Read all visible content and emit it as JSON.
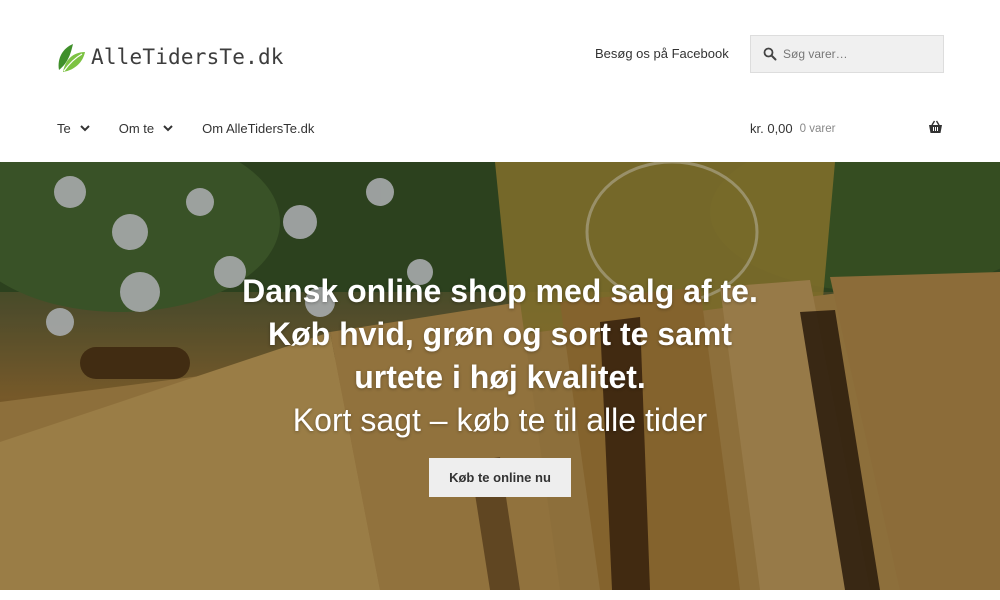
{
  "header": {
    "logo_text": "AlleTidersTe.dk",
    "facebook_link": "Besøg os på Facebook",
    "search": {
      "placeholder": "Søg varer…",
      "value": ""
    },
    "nav": [
      {
        "label": "Te",
        "has_dropdown": true
      },
      {
        "label": "Om te",
        "has_dropdown": true
      },
      {
        "label": "Om AlleTidersTe.dk",
        "has_dropdown": false
      }
    ],
    "cart": {
      "amount": "kr. 0,00",
      "count": "0 varer"
    }
  },
  "hero": {
    "title": "Dansk online shop med salg af te. Køb hvid, grøn og sort te samt urtete i høj kvalitet.",
    "subtitle": "Kort sagt – køb te til alle tider",
    "button_label": "Køb te online nu"
  },
  "colors": {
    "accent_green": "#5aa02c",
    "button_bg": "#eeeeee",
    "search_bg": "#f0f0f0"
  },
  "icons": {
    "logo": "leaf-icon",
    "search": "search-icon",
    "dropdown": "chevron-down-icon",
    "cart": "basket-icon"
  }
}
